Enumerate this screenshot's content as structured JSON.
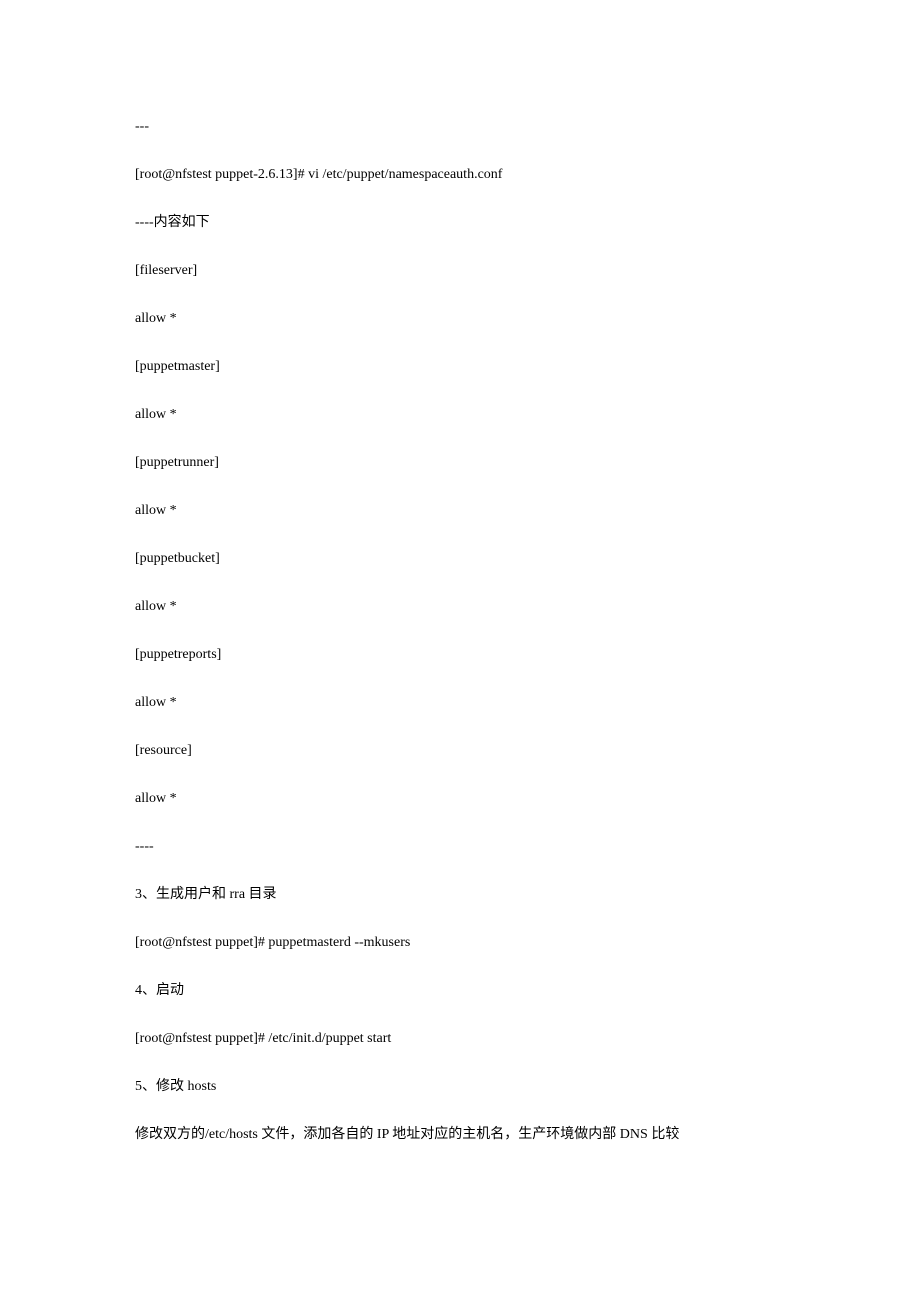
{
  "lines": [
    "---",
    "[root@nfstest puppet-2.6.13]# vi /etc/puppet/namespaceauth.conf",
    "----内容如下",
    "[fileserver]",
    "allow *",
    "[puppetmaster]",
    "allow *",
    "[puppetrunner]",
    "allow *",
    "[puppetbucket]",
    "allow *",
    "[puppetreports]",
    "allow *",
    "[resource]",
    "allow *",
    "----",
    "",
    "3、生成用户和 rra 目录",
    "[root@nfstest puppet]# puppetmasterd --mkusers",
    "4、启动",
    "[root@nfstest puppet]# /etc/init.d/puppet start",
    "5、修改 hosts",
    "修改双方的/etc/hosts 文件，添加各自的 IP 地址对应的主机名，生产环境做内部 DNS 比较"
  ]
}
